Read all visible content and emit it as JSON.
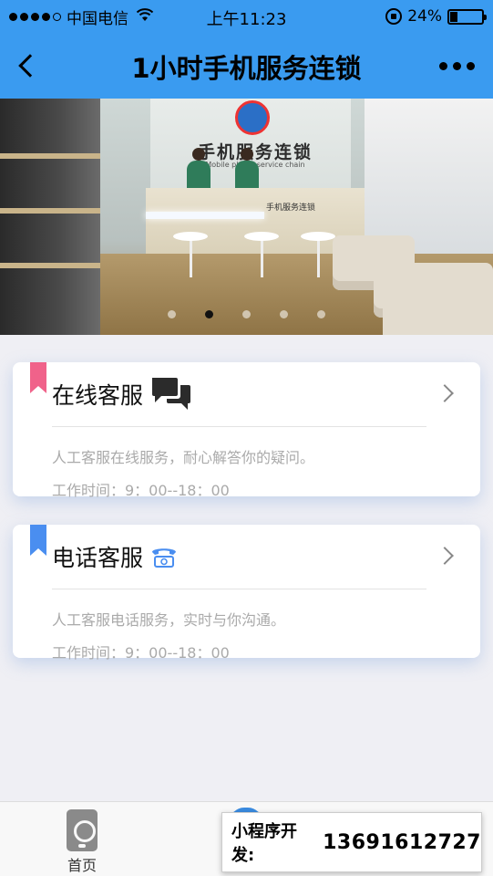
{
  "status_bar": {
    "carrier": "中国电信",
    "time": "上午11:23",
    "battery": "24%",
    "battery_level": 0.24,
    "signal_bars": 4
  },
  "nav": {
    "title": "1小时手机服务连锁"
  },
  "banner": {
    "sign_text": "手机服务连锁",
    "sign_subtitle": "Mobile phone service chain",
    "counter_logo": "手机服务连锁",
    "dot_count": 5,
    "active_dot": 1
  },
  "services": [
    {
      "title": "在线客服",
      "icon": "chat-bubbles-icon",
      "flag_color": "#f0628a",
      "description": "人工客服在线服务，耐心解答你的疑问。",
      "hours": "工作时间：9：00--18：00"
    },
    {
      "title": "电话客服",
      "icon": "telephone-icon",
      "flag_color": "#4a8ef0",
      "description": "人工客服电话服务，实时与你沟通。",
      "hours": "工作时间：9：00--18：00"
    }
  ],
  "tabbar": {
    "home_label": "首页"
  },
  "promo": {
    "label": "小程序开发:",
    "phone": "13691612727"
  },
  "colors": {
    "nav_bg": "#3a9bf0",
    "page_bg": "#efeff4"
  }
}
